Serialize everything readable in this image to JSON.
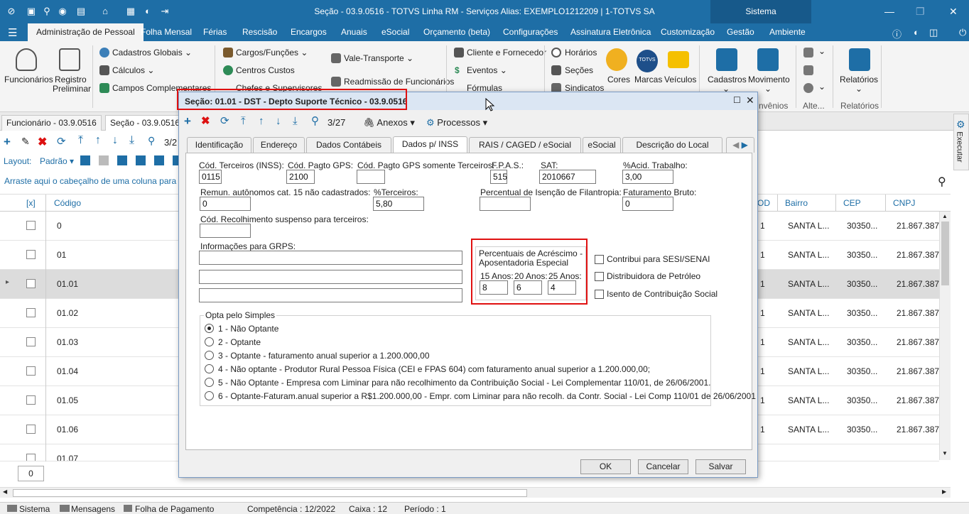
{
  "window": {
    "title": "Seção - 03.9.0516 - TOTVS Linha RM - Serviços  Alias: EXEMPLO1212209 | 1-TOTVS SA",
    "sistema_label": "Sistema"
  },
  "menu_tabs": [
    "Administração de Pessoal",
    "Folha Mensal",
    "Férias",
    "Rescisão",
    "Encargos",
    "Anuais",
    "eSocial",
    "Orçamento (beta)",
    "Configurações",
    "Assinatura Eletrônica",
    "Customização",
    "Gestão",
    "Ambiente"
  ],
  "ribbon": {
    "funcionarios": "Funcionários",
    "registro_line1": "Registro",
    "registro_line2": "Preliminar",
    "cadastros_globais": "Cadastros Globais",
    "calculos": "Cálculos",
    "campos_complementares": "Campos Complementares",
    "cargos_funcoes": "Cargos/Funções",
    "centros_custos": "Centros Custos",
    "chefes_supervisores": "Chefes e Supervisores",
    "vale_transporte": "Vale-Transporte",
    "readmissao": "Readmissão de Funcionários",
    "cliente_fornecedor": "Cliente e Fornecedor",
    "eventos": "Eventos",
    "formulas": "Fórmulas",
    "horarios": "Horários",
    "secoes": "Seções",
    "sindicatos": "Sindicatos",
    "cores": "Cores",
    "marcas": "Marcas",
    "veiculos": "Veículos",
    "cadastros": "Cadastros",
    "movimento": "Movimento",
    "convenios_partial": "nvênios",
    "alte_partial": "Alte...",
    "relatorios": "Relatórios",
    "relatorios_group": "Relatórios",
    "totvs_logo": "TOTVS"
  },
  "doc_tabs": [
    "Funcionário - 03.9.0516",
    "Seção - 03.9.0516"
  ],
  "bg": {
    "layout_label": "Layout:",
    "layout_value": "Padrão",
    "group_hint": "Arraste aqui o cabeçalho de uma coluna para agrupar",
    "pager_partial": "3/2",
    "columns": {
      "sel": "[x]",
      "codigo": "Código",
      "od_partial": "OD",
      "bairro": "Bairro",
      "cep": "CEP",
      "cnpj": "CNPJ"
    },
    "rows": [
      {
        "codigo": "0",
        "od": "1",
        "bairro": "SANTA L...",
        "cep": "30350...",
        "cnpj": "21.867.387/"
      },
      {
        "codigo": "01",
        "od": "1",
        "bairro": "SANTA L...",
        "cep": "30350...",
        "cnpj": "21.867.387/"
      },
      {
        "codigo": "01.01",
        "od": "1",
        "bairro": "SANTA L...",
        "cep": "30350...",
        "cnpj": "21.867.387/"
      },
      {
        "codigo": "01.02",
        "od": "1",
        "bairro": "SANTA L...",
        "cep": "30350...",
        "cnpj": "21.867.387/"
      },
      {
        "codigo": "01.03",
        "od": "1",
        "bairro": "SANTA L...",
        "cep": "30350...",
        "cnpj": "21.867.387/"
      },
      {
        "codigo": "01.04",
        "od": "1",
        "bairro": "SANTA L...",
        "cep": "30350...",
        "cnpj": "21.867.387/"
      },
      {
        "codigo": "01.05",
        "od": "1",
        "bairro": "SANTA L...",
        "cep": "30350...",
        "cnpj": "21.867.387/"
      },
      {
        "codigo": "01.06",
        "od": "1",
        "bairro": "SANTA L...",
        "cep": "30350...",
        "cnpj": "21.867.387/"
      },
      {
        "codigo": "01.07",
        "od": "1",
        "bairro": "SANTA L...",
        "cep": "30350...",
        "cnpj": "21.867.387/"
      }
    ],
    "count": "0",
    "executar": "Executar"
  },
  "status": {
    "sistema": "Sistema",
    "mensagens": "Mensagens",
    "folha": "Folha de Pagamento",
    "competencia": "Competência : 12/2022",
    "caixa": "Caixa : 12",
    "periodo": "Período : 1"
  },
  "dialog": {
    "title": "Seção: 01.01 - DST - Depto Suporte Técnico - 03.9.0516",
    "record_counter": "3/27",
    "anexos": "Anexos",
    "processos": "Processos",
    "tabs": [
      "Identificação",
      "Endereço",
      "Dados Contábeis",
      "Dados p/ INSS",
      "RAIS / CAGED / eSocial",
      "eSocial",
      "Descrição do Local"
    ],
    "fields": {
      "cod_terceiros_label": "Cód. Terceiros (INSS):",
      "cod_terceiros": "0115",
      "cod_pagto_gps_label": "Cód. Pagto GPS:",
      "cod_pagto_gps": "2100",
      "cod_pagto_gps_terc_label": "Cód. Pagto GPS somente Terceiros:",
      "cod_pagto_gps_terc": "",
      "fpas_label": "F.P.A.S.:",
      "fpas": "515",
      "sat_label": "SAT:",
      "sat": "2010667",
      "acid_trabalho_label": "%Acid. Trabalho:",
      "acid_trabalho": "3,00",
      "remun_label": "Remun. autônomos cat. 15 não cadastrados:",
      "remun": "0",
      "terceiros_label": "%Terceiros:",
      "terceiros": "5,80",
      "isencao_label": "Percentual de Isenção de Filantropia:",
      "isencao": "",
      "faturamento_label": "Faturamento Bruto:",
      "faturamento": "0",
      "recolhimento_label": "Cód. Recolhimento suspenso para terceiros:",
      "recolhimento": "",
      "grps_label": "Informações para GRPS:",
      "grps": [
        "",
        "",
        ""
      ]
    },
    "aposentadoria": {
      "title_line1": "Percentuais de Acréscimo -",
      "title_line2": "Aposentadoria Especial",
      "labels": [
        "15 Anos:",
        "20 Anos:",
        "25 Anos:"
      ],
      "values": [
        "8",
        "6",
        "4"
      ]
    },
    "checks": [
      "Contribui para SESI/SENAI",
      "Distribuidora de Petróleo",
      "Isento de Contribuição Social"
    ],
    "simples": {
      "legend": "Opta pelo Simples",
      "options": [
        "1 - Não Optante",
        "2 - Optante",
        "3 - Optante - faturamento anual superior a 1.200.000,00",
        "4 - Não optante - Produtor Rural Pessoa Física (CEI e FPAS 604)  com faturamento anual superior a 1.200.000,00;",
        "5 - Não Optante - Empresa com Liminar para não recolhimento da Contribuição Social - Lei Complementar 110/01, de 26/06/2001.",
        "6 - Optante-Faturam.anual superior a R$1.200.000,00 - Empr. com Liminar para não recolh. da Contr. Social - Lei Comp 110/01 de 26/06/2001"
      ],
      "selected": 0
    },
    "buttons": {
      "ok": "OK",
      "cancel": "Cancelar",
      "save": "Salvar"
    }
  }
}
